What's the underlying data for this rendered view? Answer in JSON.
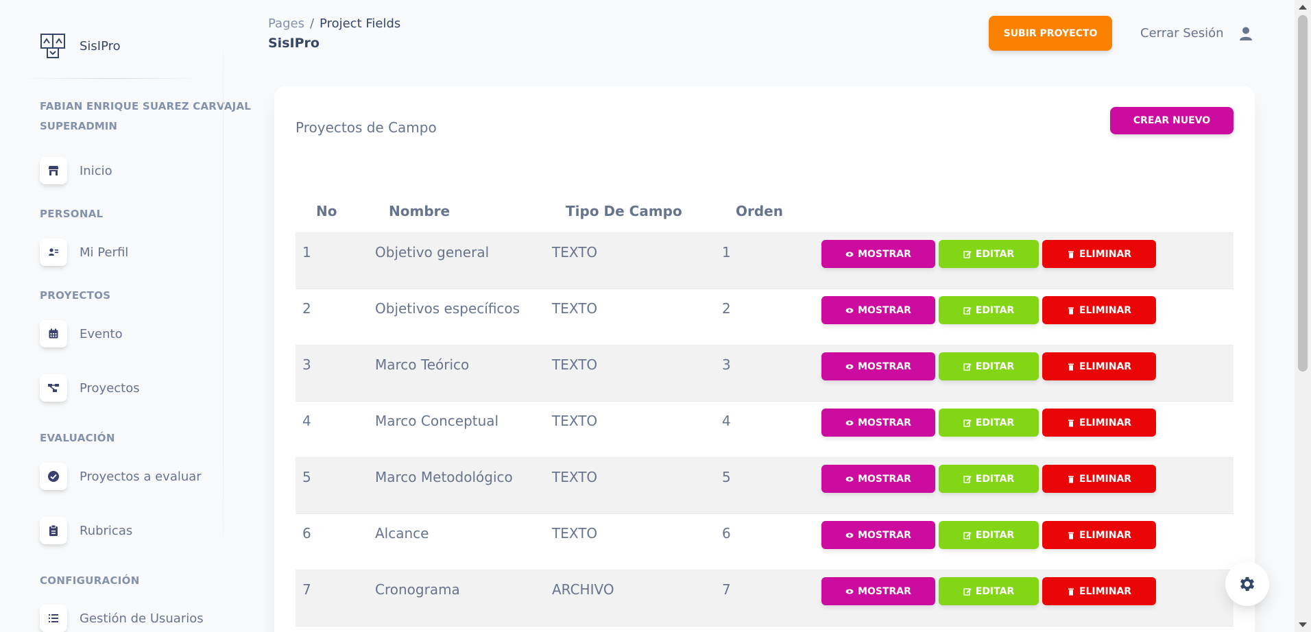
{
  "brand": {
    "name": "SisIPro"
  },
  "user": {
    "name": "FABIAN ENRIQUE SUAREZ CARVAJAL",
    "role": "SUPERADMIN"
  },
  "sidebar": {
    "home": {
      "label": "Inicio",
      "icon": "store-icon"
    },
    "sections": {
      "personal": "PERSONAL",
      "proyectos": "PROYECTOS",
      "evaluacion": "EVALUACIÓN",
      "configuracion": "CONFIGURACIÓN"
    },
    "items": {
      "perfil": {
        "label": "Mi Perfil",
        "icon": "id-card-icon"
      },
      "evento": {
        "label": "Evento",
        "icon": "calendar-icon"
      },
      "proyectos": {
        "label": "Proyectos",
        "icon": "diagram-icon"
      },
      "evaluar": {
        "label": "Proyectos a evaluar",
        "icon": "check-circle-icon"
      },
      "rubricas": {
        "label": "Rubricas",
        "icon": "clipboard-icon"
      },
      "usuarios": {
        "label": "Gestión de Usuarios",
        "icon": "list-icon"
      }
    }
  },
  "header": {
    "breadcrumb": {
      "root": "Pages",
      "separator": "/",
      "current": "Project Fields"
    },
    "title": "SisIPro",
    "upload_label": "SUBIR PROYECTO",
    "logout_label": "Cerrar Sesión"
  },
  "card": {
    "title": "Proyectos de Campo",
    "create_label": "CREAR NUEVO",
    "columns": {
      "no": "No",
      "nombre": "Nombre",
      "tipo": "Tipo De Campo",
      "orden": "Orden"
    },
    "action_labels": {
      "show": "MOSTRAR",
      "edit": "EDITAR",
      "delete": "ELIMINAR"
    },
    "rows": [
      {
        "no": "1",
        "nombre": "Objetivo general",
        "tipo": "TEXTO",
        "orden": "1"
      },
      {
        "no": "2",
        "nombre": "Objetivos específicos",
        "tipo": "TEXTO",
        "orden": "2"
      },
      {
        "no": "3",
        "nombre": "Marco Teórico",
        "tipo": "TEXTO",
        "orden": "3"
      },
      {
        "no": "4",
        "nombre": "Marco Conceptual",
        "tipo": "TEXTO",
        "orden": "4"
      },
      {
        "no": "5",
        "nombre": "Marco Metodológico",
        "tipo": "TEXTO",
        "orden": "5"
      },
      {
        "no": "6",
        "nombre": "Alcance",
        "tipo": "TEXTO",
        "orden": "6"
      },
      {
        "no": "7",
        "nombre": "Cronograma",
        "tipo": "ARCHIVO",
        "orden": "7"
      }
    ]
  },
  "colors": {
    "primary": "#cb0c9f",
    "warning": "#fb8100",
    "success": "#82d616",
    "danger": "#ea0606",
    "text": "#67748e",
    "heading": "#344767"
  }
}
